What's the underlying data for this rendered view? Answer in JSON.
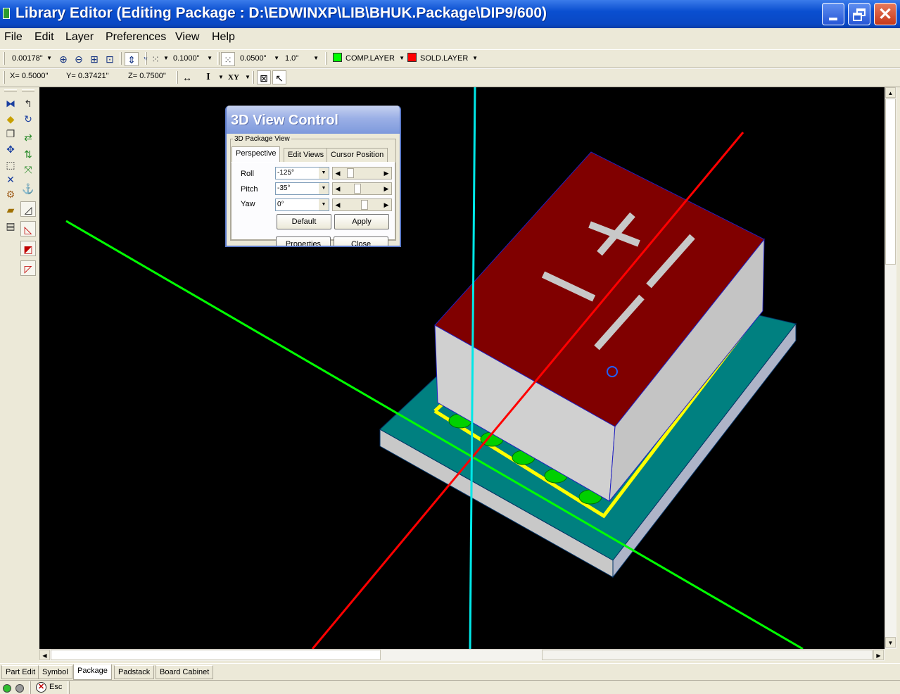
{
  "window": {
    "title": "Library Editor (Editing Package : D:\\EDWINXP\\LIB\\BHUK.Package\\DIP9/600)",
    "minimize_icon": "minimize-icon",
    "restore_icon": "restore-icon",
    "close_label": "✕"
  },
  "menu": [
    {
      "label": "File"
    },
    {
      "label": "Edit"
    },
    {
      "label": "Layer"
    },
    {
      "label": "Preferences"
    },
    {
      "label": "View"
    },
    {
      "label": "Help"
    }
  ],
  "toolbar1": {
    "zoom_step": "0.00178\"",
    "grid_size": "0.1000\"",
    "snap_size": "0.0500\"",
    "scale": "1.0\"",
    "comp_layer": {
      "label": "COMP.LAYER",
      "color": "#00ff00"
    },
    "sold_layer": {
      "label": "SOLD.LAYER",
      "color": "#ff0000"
    }
  },
  "toolbar2": {
    "x": "X= 0.5000\"",
    "y": "Y= 0.37421\"",
    "z": "Z= 0.7500\"",
    "text_tool": "I",
    "xy_tool": "XY"
  },
  "dialog": {
    "title": "3D View Control",
    "group": "3D Package View",
    "tabs": [
      "Perspective",
      "Edit Views",
      "Cursor Position"
    ],
    "active_tab": "Perspective",
    "fields": [
      {
        "label": "Roll",
        "value": "-125°"
      },
      {
        "label": "Pitch",
        "value": "-35°"
      },
      {
        "label": "Yaw",
        "value": "0°"
      }
    ],
    "buttons": {
      "default": "Default",
      "apply": "Apply",
      "properties": "Properties",
      "close": "Close"
    }
  },
  "tabs": [
    {
      "label": "Part Edit"
    },
    {
      "label": "Symbol"
    },
    {
      "label": "Package"
    },
    {
      "label": "Padstack"
    },
    {
      "label": "Board Cabinet"
    }
  ],
  "active_tab": "Package",
  "status": {
    "esc_label": "Esc",
    "indicator_on_color": "#2fbf2f",
    "indicator_off_color": "#9a9a9a"
  },
  "scene_colors": {
    "background": "#000000",
    "board": "#008080",
    "component_top": "#800000",
    "component_side": "#c8c8c8",
    "silkscreen": "#ffff00",
    "pads": "#00d000",
    "axis_x": "#ff0000",
    "axis_y": "#00ff00",
    "axis_z": "#00e8e8"
  }
}
